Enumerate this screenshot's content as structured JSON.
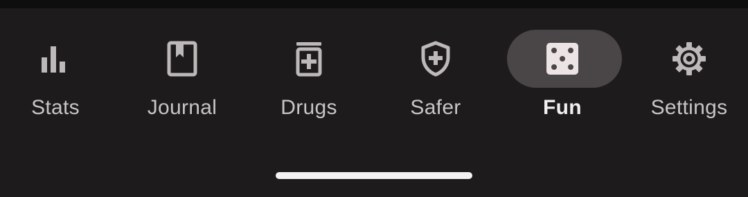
{
  "bottom_nav": {
    "items": [
      {
        "label": "Stats",
        "icon": "bar-chart-icon",
        "active": false
      },
      {
        "label": "Journal",
        "icon": "journal-book-icon",
        "active": false
      },
      {
        "label": "Drugs",
        "icon": "medication-bottle-icon",
        "active": false
      },
      {
        "label": "Safer",
        "icon": "shield-plus-icon",
        "active": false
      },
      {
        "label": "Fun",
        "icon": "dice-icon",
        "active": true
      },
      {
        "label": "Settings",
        "icon": "gear-icon",
        "active": false
      }
    ]
  },
  "colors": {
    "background": "#1d1b1c",
    "active_pill": "#4a4546",
    "icon_inactive": "#bdb8b9",
    "icon_active": "#ece3e5",
    "label_inactive": "#c9c5c6",
    "label_active": "#f2eff0",
    "home_indicator": "#f4f2f3"
  }
}
